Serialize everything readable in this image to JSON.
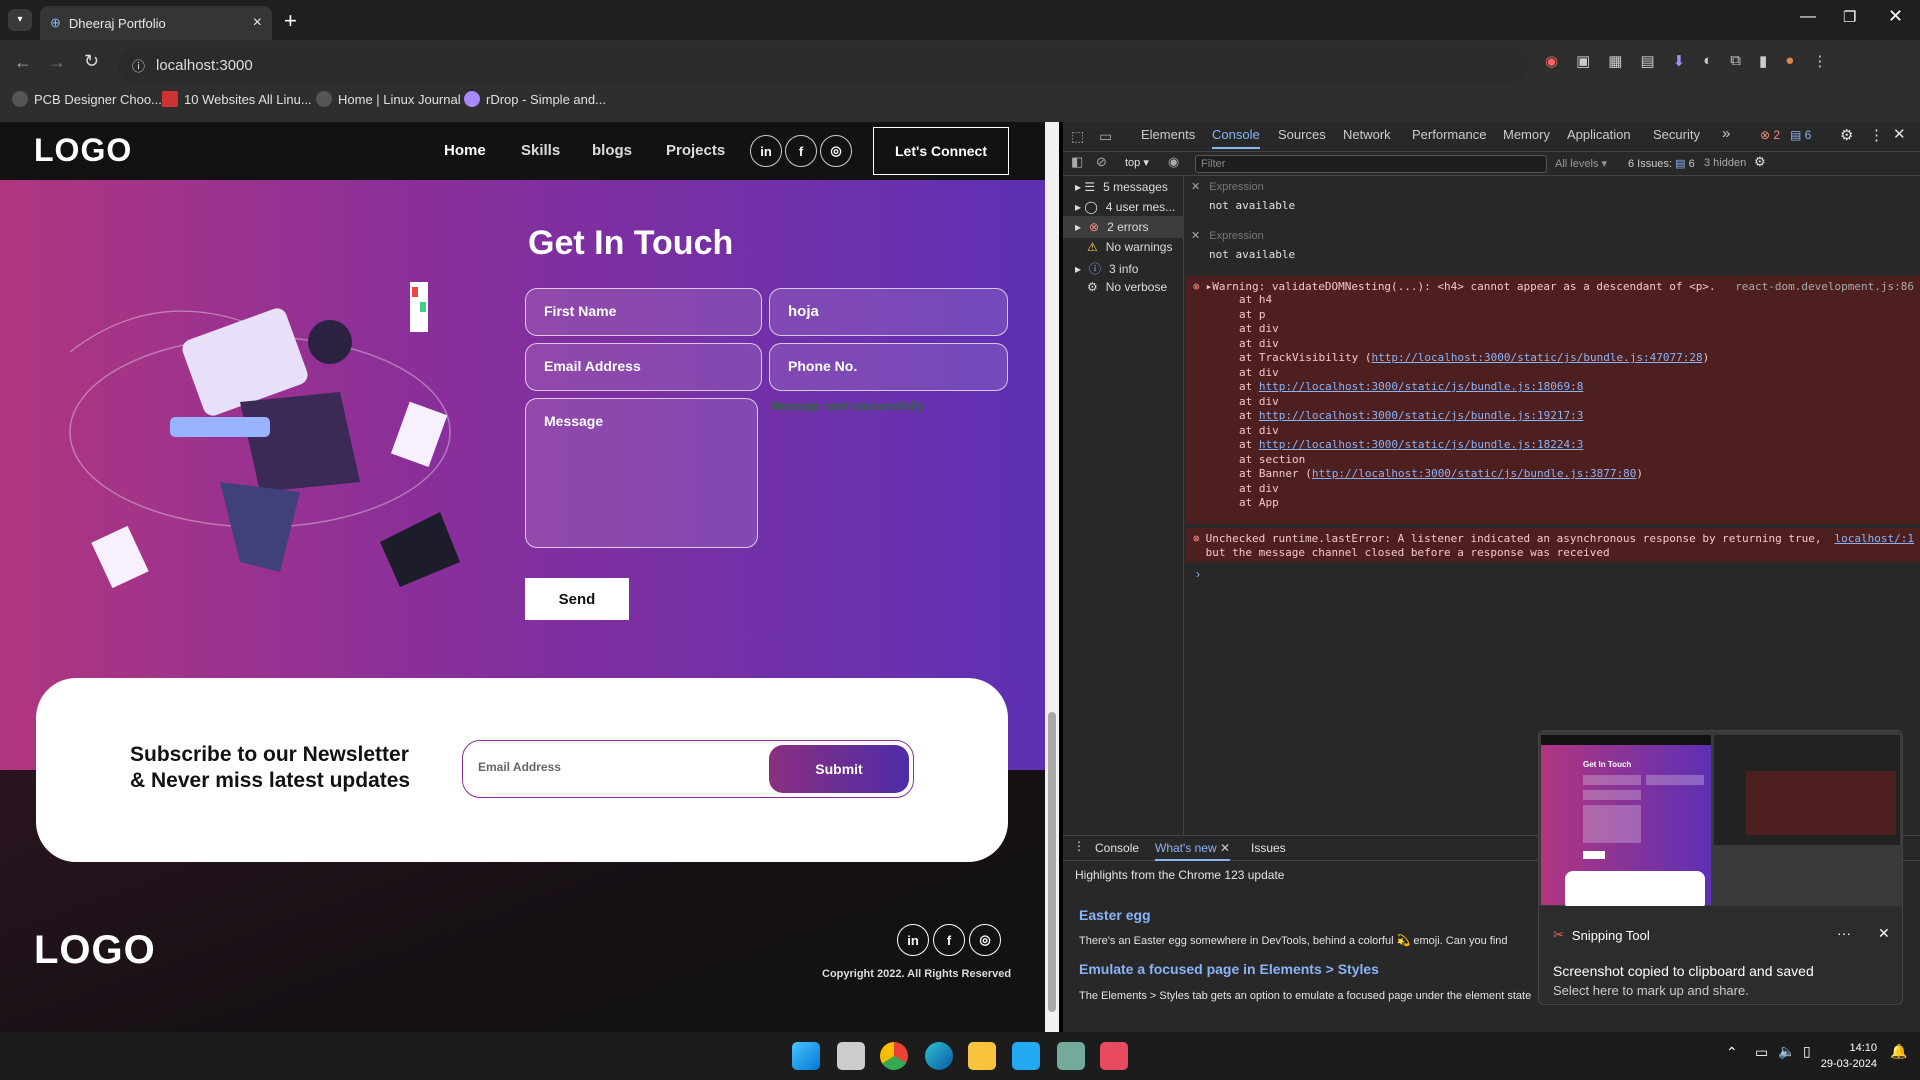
{
  "browser": {
    "tab_title": "Dheeraj Portfolio",
    "url": "localhost:3000",
    "bookmarks": [
      "PCB Designer Choo...",
      "10 Websites All Linu...",
      "Home | Linux Journal",
      "rDrop - Simple and..."
    ]
  },
  "site": {
    "nav": {
      "logo": "LOGO",
      "links": [
        "Home",
        "Skills",
        "blogs",
        "Projects"
      ],
      "social": [
        "in",
        "f",
        "◎"
      ],
      "connect": "Let's Connect"
    },
    "contact": {
      "title": "Get In Touch",
      "first_name": "First Name",
      "last_name_value": "hoja",
      "email": "Email Address",
      "phone": "Phone No.",
      "message": "Message",
      "status": "Message sent successfully",
      "send": "Send"
    },
    "newsletter": {
      "line1": "Subscribe to our Newsletter",
      "line2": "& Never miss latest updates",
      "email_placeholder": "Email Address",
      "submit": "Submit"
    },
    "footer": {
      "logo": "LOGO",
      "copyright": "Copyright 2022. All Rights Reserved"
    }
  },
  "devtools": {
    "tabs": [
      "Elements",
      "Console",
      "Sources",
      "Network",
      "Performance",
      "Memory",
      "Application",
      "Security"
    ],
    "error_count": "2",
    "issue_count": "6",
    "toolbar": {
      "context": "top",
      "filter_placeholder": "Filter",
      "levels": "All levels",
      "issues": "6 Issues:",
      "issues_n": "6",
      "hidden": "3 hidden"
    },
    "sidebar": [
      "5 messages",
      "4 user mes...",
      "2 errors",
      "No warnings",
      "3 info",
      "No verbose"
    ],
    "expressions": [
      {
        "label": "Expression",
        "value": "not available"
      },
      {
        "label": "Expression",
        "value": "not available"
      }
    ],
    "warning": {
      "text": "Warning: validateDOMNesting(...): <h4> cannot appear as a descendant of <p>.",
      "source": "react-dom.development.js:86",
      "stack": [
        {
          "pre": "at h4",
          "link": ""
        },
        {
          "pre": "at p",
          "link": ""
        },
        {
          "pre": "at div",
          "link": ""
        },
        {
          "pre": "at div",
          "link": ""
        },
        {
          "pre": "at TrackVisibility (",
          "link": "http://localhost:3000/static/js/bundle.js:47077:28",
          "post": ")"
        },
        {
          "pre": "at div",
          "link": ""
        },
        {
          "pre": "at ",
          "link": "http://localhost:3000/static/js/bundle.js:18069:8"
        },
        {
          "pre": "at div",
          "link": ""
        },
        {
          "pre": "at ",
          "link": "http://localhost:3000/static/js/bundle.js:19217:3"
        },
        {
          "pre": "at div",
          "link": ""
        },
        {
          "pre": "at ",
          "link": "http://localhost:3000/static/js/bundle.js:18224:3"
        },
        {
          "pre": "at section",
          "link": ""
        },
        {
          "pre": "at Banner (",
          "link": "http://localhost:3000/static/js/bundle.js:3877:80",
          "post": ")"
        },
        {
          "pre": "at div",
          "link": ""
        },
        {
          "pre": "at App",
          "link": ""
        }
      ]
    },
    "error2": {
      "text": "Unchecked runtime.lastError: A listener indicated an asynchronous response by returning true, but the message channel closed before a response was received",
      "source": "localhost/:1"
    },
    "drawer": {
      "tabs": [
        "Console",
        "What's new",
        "Issues"
      ],
      "highlights": "Highlights from the Chrome 123 update",
      "h1": "Easter egg",
      "p1": "There's an Easter egg somewhere in DevTools, behind a colorful 💫 emoji. Can you find",
      "h2": "Emulate a focused page in Elements > Styles",
      "p2": "The Elements > Styles tab gets an option to emulate a focused page under the element state"
    }
  },
  "toast": {
    "app": "Snipping Tool",
    "title": "Screenshot copied to clipboard and saved",
    "body": "Select here to mark up and share.",
    "thumb_title": "Get In Touch"
  },
  "tray": {
    "time": "14:10",
    "date": "29-03-2024"
  }
}
